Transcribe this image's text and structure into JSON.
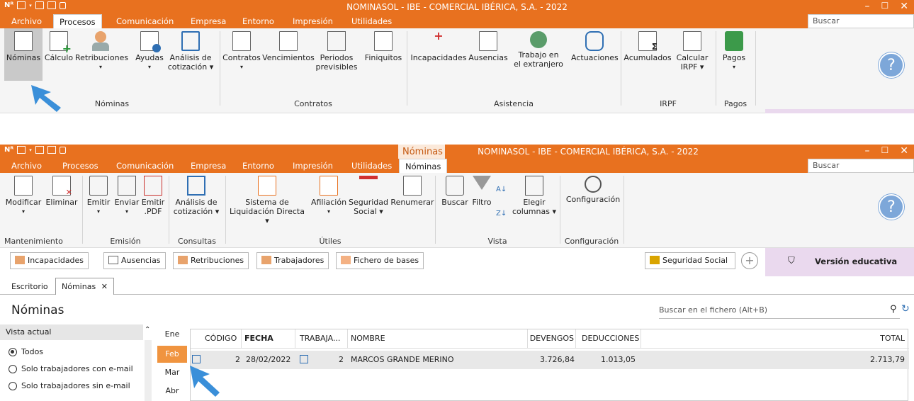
{
  "window": {
    "qat_icon": "ns-app-icon",
    "title": "NOMINASOL - IBE - COMERCIAL IBÉRICA, S.A. - 2022",
    "search_placeholder": "Buscar",
    "min_glyph": "–",
    "max_glyph": "☐",
    "close_glyph": "✕"
  },
  "menu_tabs": [
    "Archivo",
    "Procesos",
    "Comunicación",
    "Empresa",
    "Entorno",
    "Impresión",
    "Utilidades"
  ],
  "ribbon1": {
    "buttons": [
      "Nóminas",
      "Cálculo",
      "Retribuciones",
      "Ayudas",
      "Análisis de",
      "cotización ▾",
      "Contratos",
      "Vencimientos",
      "Periodos",
      "previsibles",
      "Finiquitos",
      "Incapacidades",
      "Ausencias",
      "Trabajo en",
      "el extranjero",
      "Actuaciones",
      "Acumulados",
      "Calcular",
      "IRPF ▾",
      "Pagos"
    ],
    "groups": [
      "Nóminas",
      "Contratos",
      "Asistencia",
      "IRPF",
      "Pagos"
    ]
  },
  "context": {
    "label": "Nóminas",
    "tab_label": "Nóminas"
  },
  "ribbon2": {
    "buttons": [
      "Modificar",
      "Eliminar",
      "Emitir",
      "Enviar",
      "Emitir",
      ".PDF",
      "Análisis de",
      "cotización ▾",
      "Sistema de",
      "Liquidación Directa ▾",
      "Afiliación",
      "Seguridad",
      "Social ▾",
      "Renumerar",
      "Buscar",
      "Filtro",
      "Elegir",
      "columnas ▾",
      "Configuración"
    ],
    "groups": [
      "Mantenimiento",
      "Emisión",
      "Consultas",
      "Útiles",
      "Vista",
      "Configuración"
    ]
  },
  "quick_bar": {
    "buttons": [
      "Incapacidades",
      "Ausencias",
      "Retribuciones",
      "Trabajadores",
      "Fichero de bases"
    ],
    "seguridad_social": "Seguridad Social",
    "add_glyph": "+",
    "edu_label": "Versión educativa"
  },
  "doc_tabs": {
    "escritorio": "Escritorio",
    "nominas": "Nóminas",
    "close": "✕"
  },
  "page": {
    "heading": "Nóminas",
    "file_search_placeholder": "Buscar en el fichero (Alt+B)"
  },
  "filter_panel": {
    "title": "Vista actual",
    "options": [
      "Todos",
      "Solo trabajadores con e-mail",
      "Solo trabajadores sin e-mail"
    ],
    "selected": 0
  },
  "months": [
    "Ene",
    "Feb",
    "Mar",
    "Abr"
  ],
  "active_month": "Feb",
  "table": {
    "columns": [
      "CÓDIGO",
      "FECHA",
      "TRABAJA...",
      "NOMBRE",
      "DEVENGOS",
      "DEDUCCIONES",
      "TOTAL"
    ],
    "rows": [
      {
        "codigo": "2",
        "fecha": "28/02/2022",
        "trabajador": "2",
        "nombre": "MARCOS GRANDE MERINO",
        "devengos": "3.726,84",
        "deducciones": "1.013,05",
        "total": "2.713,79"
      }
    ]
  },
  "colors": {
    "accent": "#e8711f",
    "selected_month": "#f0943f",
    "edu_bg": "#ead9ee",
    "row_bg": "#e8e8e8",
    "cursor": "#3a8fd9"
  }
}
